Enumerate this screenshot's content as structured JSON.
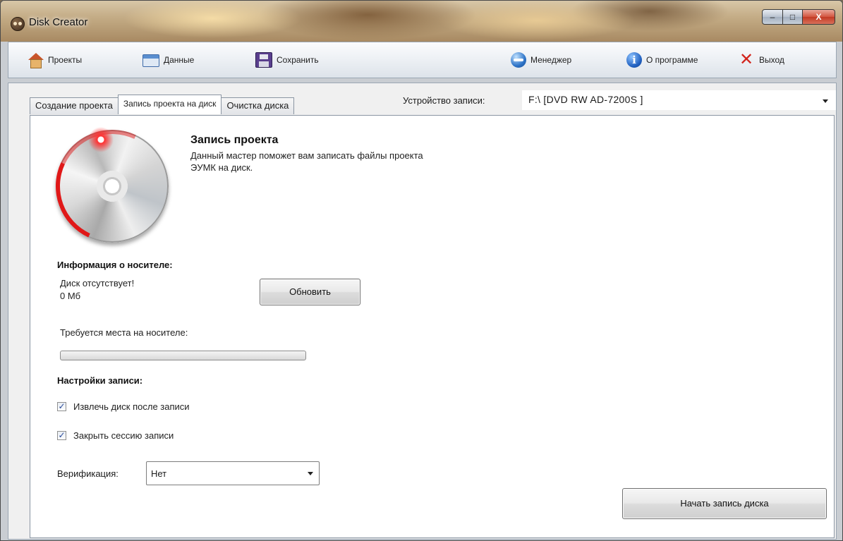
{
  "window": {
    "title": "Disk Creator",
    "controls": {
      "minimize": "–",
      "maximize": "□",
      "close": "X"
    }
  },
  "toolbar": {
    "items": [
      {
        "label": "Проекты",
        "icon": "house-icon"
      },
      {
        "label": "Данные",
        "icon": "window-icon"
      },
      {
        "label": "Сохранить",
        "icon": "floppy-icon"
      },
      {
        "label": "Менеджер",
        "icon": "globe-icon"
      },
      {
        "label": "О программе",
        "icon": "info-icon"
      },
      {
        "label": "Выход",
        "icon": "close-x-icon"
      }
    ]
  },
  "tabs": [
    {
      "label": "Создание проекта",
      "active": false
    },
    {
      "label": "Запись проекта на диск",
      "active": true
    },
    {
      "label": "Очистка диска",
      "active": false
    }
  ],
  "device": {
    "label": "Устройство записи:",
    "value": "F:\\ [DVD RW AD-7200S ]"
  },
  "wizard": {
    "title": "Запись проекта",
    "description": "Данный мастер поможет вам записать файлы проекта ЭУМК на диск."
  },
  "media": {
    "heading": "Информация о носителе:",
    "status": "Диск отсутствует!",
    "size": "0 Мб",
    "refresh_label": "Обновить",
    "required_label": "Требуется места на носителе:",
    "required_progress": 0
  },
  "settings": {
    "heading": "Настройки записи:",
    "eject_label": "Извлечь диск после записи",
    "eject_checked": true,
    "close_session_label": "Закрыть сессию записи",
    "close_session_checked": true,
    "verification_label": "Верификация:",
    "verification_value": "Нет"
  },
  "actions": {
    "start_label": "Начать запись диска"
  },
  "colors": {
    "accent_red": "#e01818",
    "close_red": "#c23a24"
  }
}
